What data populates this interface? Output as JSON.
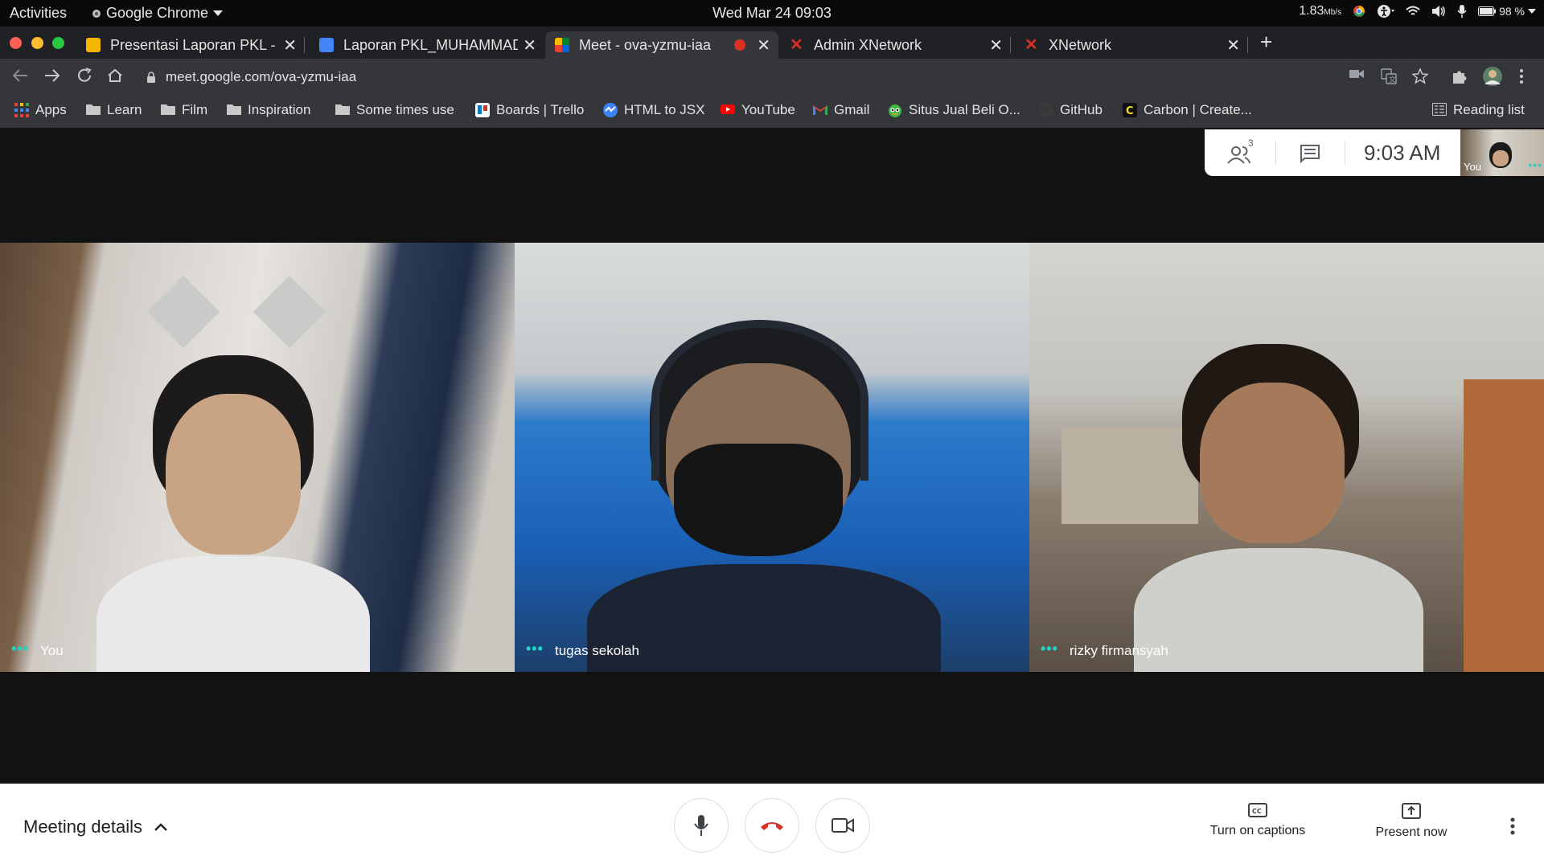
{
  "topbar": {
    "activities": "Activities",
    "app_name": "Google Chrome",
    "datetime": "Wed Mar 24  09:03",
    "net_speed": "1.83",
    "net_unit": "Mb/s",
    "battery": "98 %"
  },
  "tabs": [
    {
      "title": "Presentasi Laporan PKL - Go",
      "icon": "slides-icon",
      "color": "#f4b400"
    },
    {
      "title": "Laporan PKL_MUHAMMAD R",
      "icon": "docs-icon",
      "color": "#4285f4"
    },
    {
      "title": "Meet - ova-yzmu-iaa",
      "icon": "meet-icon",
      "color": "#00832d"
    },
    {
      "title": "Admin XNetwork",
      "icon": "x-icon",
      "color": "#d93025"
    },
    {
      "title": "XNetwork",
      "icon": "x-icon",
      "color": "#d93025"
    }
  ],
  "omnibox": {
    "url": "meet.google.com/ova-yzmu-iaa"
  },
  "bookmarks": [
    {
      "label": "Apps",
      "icon": "apps-grid-icon"
    },
    {
      "label": "Learn",
      "icon": "folder-icon"
    },
    {
      "label": "Film",
      "icon": "folder-icon"
    },
    {
      "label": "Inspiration",
      "icon": "folder-icon"
    },
    {
      "label": "Some times use",
      "icon": "folder-icon"
    },
    {
      "label": "Boards | Trello",
      "icon": "trello-icon"
    },
    {
      "label": "HTML to JSX",
      "icon": "transform-icon"
    },
    {
      "label": "YouTube",
      "icon": "youtube-icon"
    },
    {
      "label": "Gmail",
      "icon": "gmail-icon"
    },
    {
      "label": "Situs Jual Beli O...",
      "icon": "tokopedia-icon"
    },
    {
      "label": "GitHub",
      "icon": "github-icon"
    },
    {
      "label": "Carbon | Create...",
      "icon": "carbon-icon"
    }
  ],
  "reading_list": "Reading list",
  "meet": {
    "participants_count": "3",
    "clock": "9:03  AM",
    "self_thumb_label": "You",
    "tiles": [
      {
        "name": "You"
      },
      {
        "name": "tugas sekolah"
      },
      {
        "name": "rizky firmansyah"
      }
    ]
  },
  "controls": {
    "meeting_details": "Meeting details",
    "captions": "Turn on captions",
    "present": "Present now"
  },
  "colors": {
    "accent_teal": "#21d3c6",
    "hangup_red": "#d93025"
  }
}
